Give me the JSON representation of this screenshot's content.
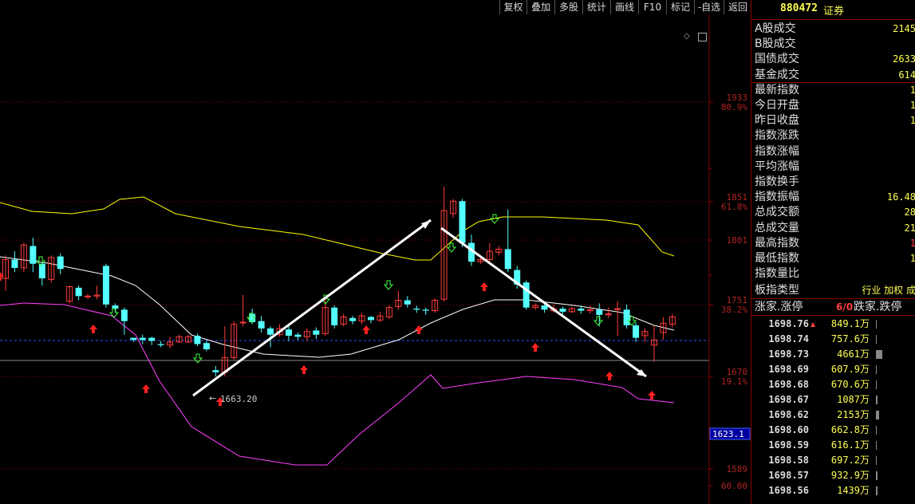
{
  "toolbar": {
    "buttons": [
      "复权",
      "叠加",
      "多股",
      "统计",
      "画线",
      "F10",
      "标记",
      "-自选",
      "返回"
    ]
  },
  "chart_data": {
    "type": "candlestick",
    "y_axis_ticks": [
      {
        "value": "1933",
        "pct": "80.9%"
      },
      {
        "value": "1851",
        "pct": "61.8%"
      },
      {
        "value": "1801",
        "pct": ""
      },
      {
        "value": "1751",
        "pct": "38.2%"
      },
      {
        "value": "1670",
        "pct": "19.1%"
      },
      {
        "value": "1589",
        "pct": ""
      },
      {
        "value": "60.00",
        "pct": ""
      }
    ],
    "current_price_label": "1623.1",
    "low_annotation": "1663.20",
    "colors": {
      "up": "#ff3c3c",
      "down": "#54ffff",
      "mid_band": "#ffffff",
      "upper_band": "#ffff00",
      "lower_band": "#ff40ff",
      "grid": "#8b0000",
      "trendline": "#ffffff"
    },
    "candles": [
      [
        1764,
        1782,
        1752,
        1786
      ],
      [
        1782,
        1774,
        1770,
        1790
      ],
      [
        1774,
        1796,
        1770,
        1798
      ],
      [
        1795,
        1778,
        1770,
        1803
      ],
      [
        1778,
        1764,
        1757,
        1780
      ],
      [
        1763,
        1784,
        1760,
        1786
      ],
      [
        1785,
        1773,
        1768,
        1788
      ],
      [
        1742,
        1756,
        1740,
        1757
      ],
      [
        1755,
        1747,
        1743,
        1757
      ],
      [
        1747,
        1747,
        1744,
        1749
      ],
      [
        1747,
        1748,
        1744,
        1757
      ],
      [
        1776,
        1739,
        1736,
        1778
      ],
      [
        1738,
        1735,
        1731,
        1740
      ],
      [
        1734,
        1723,
        1710,
        1736
      ],
      [
        1707,
        1705,
        1703,
        1707
      ],
      [
        1707,
        1705,
        1701,
        1710
      ],
      [
        1707,
        1704,
        1700,
        1708
      ],
      [
        1701,
        1700,
        1698,
        1704
      ],
      [
        1700,
        1703,
        1697,
        1708
      ],
      [
        1703,
        1708,
        1702,
        1710
      ],
      [
        1703,
        1708,
        1702,
        1710
      ],
      [
        1709,
        1701,
        1699,
        1711
      ],
      [
        1702,
        1696,
        1694,
        1704
      ],
      [
        1676,
        1674,
        1670,
        1680
      ],
      [
        1674,
        1688,
        1670,
        1718
      ],
      [
        1688,
        1720,
        1686,
        1723
      ],
      [
        1722,
        1722,
        1718,
        1748
      ],
      [
        1730,
        1722,
        1720,
        1735
      ],
      [
        1723,
        1716,
        1712,
        1728
      ],
      [
        1716,
        1710,
        1698,
        1718
      ],
      [
        1710,
        1716,
        1708,
        1720
      ],
      [
        1715,
        1709,
        1704,
        1718
      ],
      [
        1710,
        1708,
        1705,
        1712
      ],
      [
        1708,
        1713,
        1704,
        1716
      ],
      [
        1714,
        1710,
        1706,
        1717
      ],
      [
        1711,
        1736,
        1709,
        1744
      ],
      [
        1736,
        1719,
        1716,
        1738
      ],
      [
        1720,
        1727,
        1718,
        1730
      ],
      [
        1726,
        1723,
        1720,
        1728
      ],
      [
        1723,
        1728,
        1720,
        1731
      ],
      [
        1727,
        1724,
        1721,
        1728
      ],
      [
        1724,
        1728,
        1722,
        1732
      ],
      [
        1727,
        1736,
        1725,
        1738
      ],
      [
        1737,
        1743,
        1734,
        1752
      ],
      [
        1743,
        1739,
        1736,
        1747
      ],
      [
        1735,
        1734,
        1731,
        1738
      ],
      [
        1734,
        1733,
        1729,
        1736
      ],
      [
        1733,
        1743,
        1731,
        1745
      ],
      [
        1744,
        1829,
        1742,
        1852
      ],
      [
        1826,
        1838,
        1822,
        1840
      ],
      [
        1838,
        1798,
        1794,
        1840
      ],
      [
        1798,
        1780,
        1776,
        1806
      ],
      [
        1780,
        1782,
        1778,
        1786
      ],
      [
        1782,
        1790,
        1780,
        1798
      ],
      [
        1789,
        1792,
        1786,
        1795
      ],
      [
        1792,
        1773,
        1770,
        1830
      ],
      [
        1772,
        1758,
        1754,
        1776
      ],
      [
        1760,
        1736,
        1734,
        1762
      ],
      [
        1736,
        1738,
        1734,
        1740
      ],
      [
        1738,
        1734,
        1731,
        1742
      ],
      [
        1733,
        1735,
        1731,
        1739
      ],
      [
        1735,
        1732,
        1729,
        1737
      ],
      [
        1732,
        1735,
        1731,
        1737
      ],
      [
        1735,
        1733,
        1730,
        1738
      ],
      [
        1733,
        1734,
        1730,
        1738
      ],
      [
        1734,
        1729,
        1718,
        1740
      ],
      [
        1729,
        1730,
        1726,
        1736
      ],
      [
        1734,
        1735,
        1709,
        1742
      ],
      [
        1734,
        1719,
        1716,
        1739
      ],
      [
        1719,
        1707,
        1703,
        1722
      ],
      [
        1709,
        1713,
        1703,
        1716
      ],
      [
        1700,
        1705,
        1684,
        1719
      ],
      [
        1712,
        1721,
        1705,
        1727
      ],
      [
        1720,
        1727,
        1717,
        1730
      ]
    ]
  },
  "security": {
    "code": "880472",
    "name": "证券"
  },
  "stats": [
    {
      "label": "A股成交",
      "value": "2145"
    },
    {
      "label": "B股成交",
      "value": ""
    },
    {
      "label": "国债成交",
      "value": "2633"
    },
    {
      "label": "基金成交",
      "value": "614"
    },
    {
      "label": "最新指数",
      "value": "1"
    },
    {
      "label": "今日开盘",
      "value": "1"
    },
    {
      "label": "昨日收盘",
      "value": "1"
    },
    {
      "label": "指数涨跌",
      "value": ""
    },
    {
      "label": "指数涨幅",
      "value": ""
    },
    {
      "label": "平均涨幅",
      "value": ""
    },
    {
      "label": "指数换手",
      "value": ""
    },
    {
      "label": "指数振幅",
      "value": "16.48"
    },
    {
      "label": "总成交额",
      "value": "28"
    },
    {
      "label": "总成交量",
      "value": "21"
    },
    {
      "label": "最高指数",
      "value": "1"
    },
    {
      "label": "最低指数",
      "value": "1"
    },
    {
      "label": "指数量比",
      "value": ""
    }
  ],
  "board": {
    "label": "板指类型",
    "value": "行业 加权 成"
  },
  "updown": {
    "left_label": "涨家.涨停",
    "ratio": "6/0",
    "right_label": "跌家.跌停"
  },
  "ticks": [
    {
      "price": "1698.76",
      "vol": "849.1万",
      "marker": "▲",
      "bar": 0.05
    },
    {
      "price": "1698.74",
      "vol": "757.6万",
      "marker": "",
      "bar": 0.05
    },
    {
      "price": "1698.73",
      "vol": "4661万",
      "marker": "",
      "bar": 0.4
    },
    {
      "price": "1698.69",
      "vol": "607.9万",
      "marker": "",
      "bar": 0.05
    },
    {
      "price": "1698.68",
      "vol": "670.6万",
      "marker": "",
      "bar": 0.05
    },
    {
      "price": "1698.67",
      "vol": "1087万",
      "marker": "",
      "bar": 0.1
    },
    {
      "price": "1698.62",
      "vol": "2153万",
      "marker": "",
      "bar": 0.2
    },
    {
      "price": "1698.60",
      "vol": "662.8万",
      "marker": "",
      "bar": 0.05
    },
    {
      "price": "1698.59",
      "vol": "616.1万",
      "marker": "",
      "bar": 0.05
    },
    {
      "price": "1698.58",
      "vol": "697.2万",
      "marker": "",
      "bar": 0.05
    },
    {
      "price": "1698.57",
      "vol": "932.9万",
      "marker": "",
      "bar": 0.08
    },
    {
      "price": "1698.56",
      "vol": "1439万",
      "marker": "",
      "bar": 0.12
    }
  ]
}
